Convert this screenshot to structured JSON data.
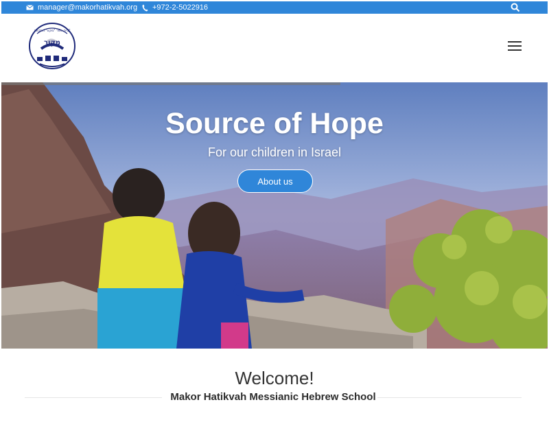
{
  "topbar": {
    "email": "manager@makorhatikvah.org",
    "phone": "+972-2-5022916",
    "icons": {
      "mail": "mail-icon",
      "phone": "phone-icon",
      "search": "search-icon"
    },
    "color": "#2f86d9"
  },
  "header": {
    "logo_text_top": "בית ספר \"מקור התקווה\"",
    "logo_text_main": "מקור",
    "menu_icon": "hamburger-menu-icon"
  },
  "hero": {
    "title": "Source of Hope",
    "subtitle": "For our children in Israel",
    "button_label": "About us",
    "slide_progress": 0.62
  },
  "welcome": {
    "heading": "Welcome!",
    "subheading": "Makor Hatikvah Messianic Hebrew School"
  },
  "colors": {
    "accent": "#2f86d9",
    "text": "#333333"
  }
}
